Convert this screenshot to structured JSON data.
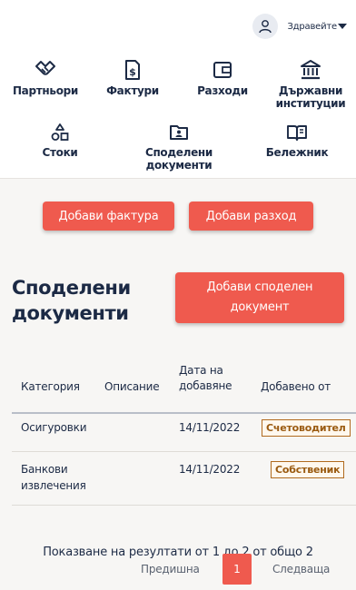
{
  "header": {
    "greeting": "Здравейте"
  },
  "nav": {
    "partners": "Партньори",
    "invoices": "Фактури",
    "expenses": "Разходи",
    "institutions_1": "Държавни",
    "institutions_2": "институции",
    "goods": "Стоки",
    "shared_1": "Споделени",
    "shared_2": "документи",
    "notebook": "Бележник"
  },
  "actions": {
    "add_invoice": "Добави фактура",
    "add_expense": "Добави разход"
  },
  "shared": {
    "title_1": "Споделени",
    "title_2": "документи",
    "add_button_1": "Добави споделен",
    "add_button_2": "документ"
  },
  "table": {
    "headers": {
      "category": "Категория",
      "description": "Описание",
      "date_1": "Дата на",
      "date_2": "добавяне",
      "added_by": "Добавено от"
    },
    "rows": [
      {
        "category_1": "Осигуровки",
        "category_2": "",
        "description": "",
        "date": "14/11/2022",
        "added_by": "Счетоводител"
      },
      {
        "category_1": "Банкови",
        "category_2": "извлечения",
        "description": "",
        "date": "14/11/2022",
        "added_by": "Собственик"
      }
    ]
  },
  "pagination": {
    "summary": "Показване на резултати от 1 до 2 от общо 2",
    "previous": "Предишна",
    "current_page": "1",
    "next": "Следваща"
  }
}
